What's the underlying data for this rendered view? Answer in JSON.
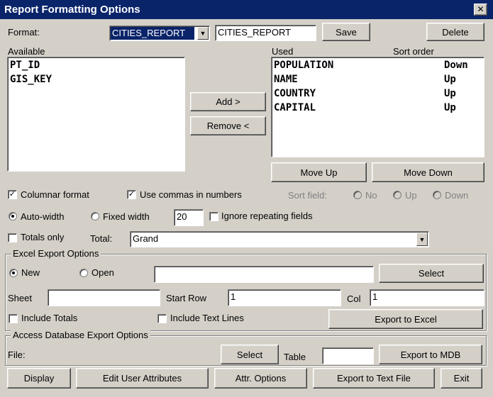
{
  "window": {
    "title": "Report Formatting Options",
    "close_glyph": "✕"
  },
  "format": {
    "label": "Format:",
    "selected": "CITIES_REPORT",
    "name_value": "CITIES_REPORT",
    "save_label": "Save",
    "delete_label": "Delete"
  },
  "available": {
    "label": "Available",
    "items": [
      "PT_ID",
      "GIS_KEY"
    ]
  },
  "used": {
    "label": "Used",
    "sort_label": "Sort order",
    "items": [
      {
        "field": "POPULATION",
        "order": "Down"
      },
      {
        "field": "NAME",
        "order": "Up"
      },
      {
        "field": "COUNTRY",
        "order": "Up"
      },
      {
        "field": "CAPITAL",
        "order": "Up"
      }
    ]
  },
  "buttons": {
    "add": "Add >",
    "remove": "Remove <",
    "move_up": "Move Up",
    "move_down": "Move Down",
    "display": "Display",
    "edit_user_attributes": "Edit User Attributes",
    "attr_options": "Attr. Options",
    "export_text": "Export to Text File",
    "exit": "Exit"
  },
  "options": {
    "columnar_format": "Columnar format",
    "use_commas": "Use commas in numbers",
    "sort_field": "Sort field:",
    "sort_no": "No",
    "sort_up": "Up",
    "sort_down": "Down",
    "auto_width": "Auto-width",
    "fixed_width": "Fixed width",
    "width_value": "20",
    "ignore_repeating": "Ignore repeating fields",
    "totals_only": "Totals only",
    "total_label": "Total:",
    "total_value": "Grand",
    "check_mark": "✓"
  },
  "excel": {
    "title": "Excel Export Options",
    "new": "New",
    "open": "Open",
    "file_value": "",
    "select": "Select",
    "sheet_label": "Sheet",
    "sheet_value": "",
    "start_row_label": "Start Row",
    "start_row_value": "1",
    "col_label": "Col",
    "col_value": "1",
    "include_totals": "Include Totals",
    "include_text_lines": "Include Text Lines",
    "export": "Export to Excel"
  },
  "access": {
    "title": "Access Database Export Options",
    "file_label": "File:",
    "select": "Select",
    "table_label": "Table",
    "table_value": "",
    "export": "Export to MDB"
  },
  "colors": {
    "titlebar": "#0a246a",
    "face": "#d4d0c8",
    "selection": "#0a246a"
  }
}
